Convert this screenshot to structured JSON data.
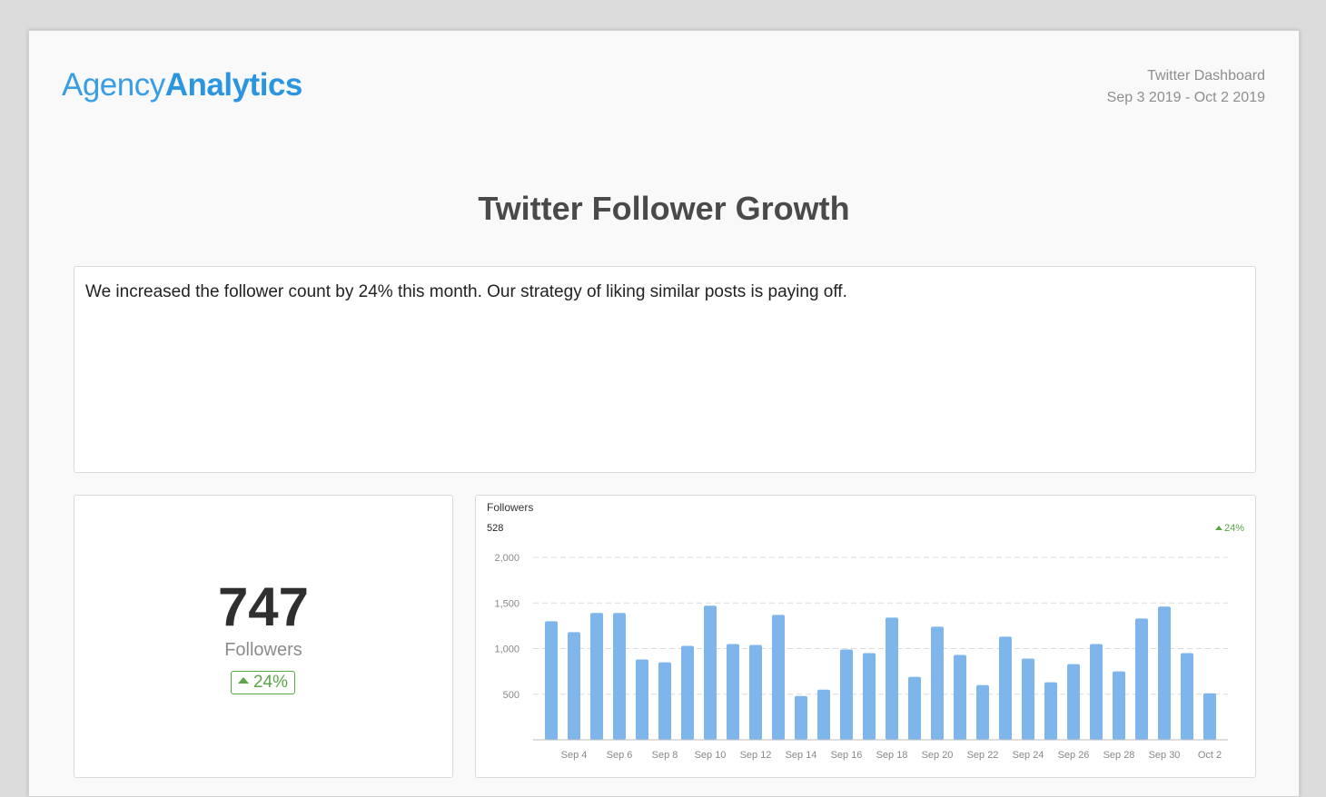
{
  "header": {
    "logo_light": "Agency",
    "logo_bold": "Analytics",
    "dashboard_name": "Twitter Dashboard",
    "date_range": "Sep 3 2019 - Oct 2 2019"
  },
  "report": {
    "title": "Twitter Follower Growth",
    "notes": "We increased the follower count by 24% this month. Our strategy of liking similar posts is paying off."
  },
  "kpi": {
    "value": "747",
    "label": "Followers",
    "change": "24%"
  },
  "chart_header": {
    "title": "Followers",
    "total": "528",
    "change": "24%"
  },
  "colors": {
    "brand": "#2b95e0",
    "bar": "#7eb6ec",
    "positive": "#5aa545"
  },
  "chart_data": {
    "type": "bar",
    "title": "Followers",
    "xlabel": "",
    "ylabel": "",
    "ylim": [
      0,
      2000
    ],
    "yticks": [
      500,
      1000,
      1500,
      2000
    ],
    "ytick_labels": [
      "500",
      "1,000",
      "1,500",
      "2,000"
    ],
    "grid": true,
    "categories": [
      "Sep 3",
      "Sep 4",
      "Sep 5",
      "Sep 6",
      "Sep 7",
      "Sep 8",
      "Sep 9",
      "Sep 10",
      "Sep 11",
      "Sep 12",
      "Sep 13",
      "Sep 14",
      "Sep 15",
      "Sep 16",
      "Sep 17",
      "Sep 18",
      "Sep 19",
      "Sep 20",
      "Sep 21",
      "Sep 22",
      "Sep 23",
      "Sep 24",
      "Sep 25",
      "Sep 26",
      "Sep 27",
      "Sep 28",
      "Sep 29",
      "Sep 30",
      "Oct 1",
      "Oct 2"
    ],
    "xtick_labels": [
      "Sep 4",
      "Sep 6",
      "Sep 8",
      "Sep 10",
      "Sep 12",
      "Sep 14",
      "Sep 16",
      "Sep 18",
      "Sep 20",
      "Sep 22",
      "Sep 24",
      "Sep 26",
      "Sep 28",
      "Sep 30",
      "Oct 2"
    ],
    "values": [
      1300,
      1180,
      1390,
      1390,
      880,
      850,
      1030,
      1470,
      1050,
      1040,
      1370,
      480,
      550,
      990,
      950,
      1340,
      690,
      1240,
      930,
      600,
      1130,
      890,
      630,
      830,
      1050,
      750,
      1330,
      1460,
      950,
      510
    ]
  }
}
